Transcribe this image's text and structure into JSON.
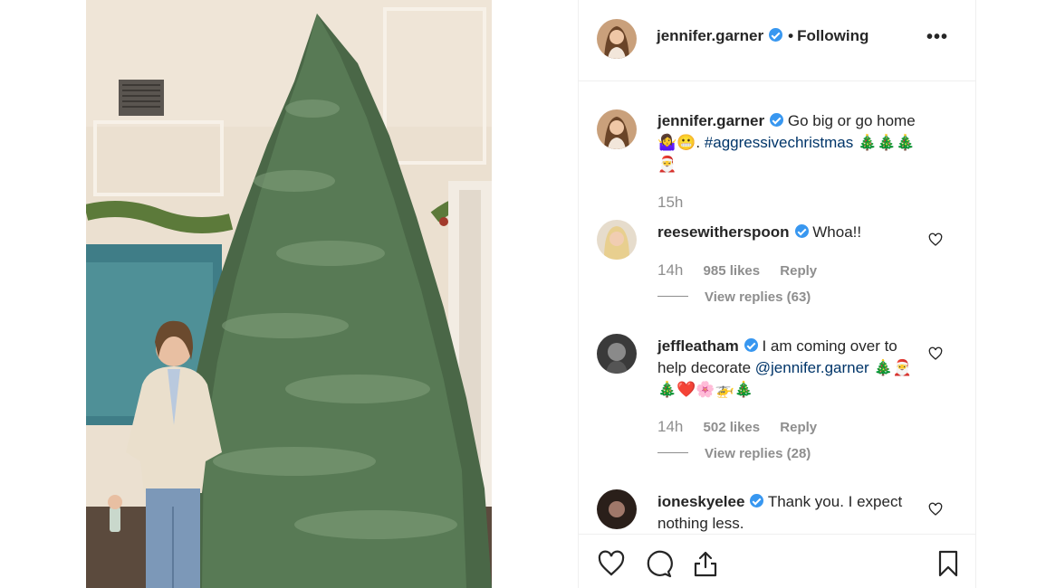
{
  "post": {
    "username": "jennifer.garner",
    "follow_state": "Following",
    "more_label": "•••",
    "separator": "•"
  },
  "caption": {
    "username": "jennifer.garner",
    "text": "Go big or go home",
    "emoji_line1": "🤷‍♀️😬.",
    "hashtag": "#aggressivechristmas",
    "emoji_trees": "🎄🎄🎄",
    "emoji_line2": "🎅",
    "time": "15h"
  },
  "comments": [
    {
      "username": "reesewitherspoon",
      "text": "Whoa!!",
      "time": "14h",
      "likes": "985 likes",
      "reply_label": "Reply",
      "view_replies": "View replies (63)"
    },
    {
      "username": "jeffleatham",
      "text": "I am coming over to help decorate",
      "mention": "@jennifer.garner",
      "emojis": "🎄🎅🎄❤️🌸🚁🎄",
      "time": "14h",
      "likes": "502 likes",
      "reply_label": "Reply",
      "view_replies": "View replies (28)"
    },
    {
      "username": "ioneskyelee",
      "text": "Thank you. I expect nothing less."
    }
  ],
  "icons": {
    "like": "heart-icon",
    "comment": "comment-icon",
    "share": "share-icon",
    "save": "bookmark-icon",
    "verified": "verified-badge-icon"
  },
  "colors": {
    "verified": "#3897f0",
    "hashtag": "#003569",
    "muted": "#8e8e8e",
    "text": "#262626"
  }
}
